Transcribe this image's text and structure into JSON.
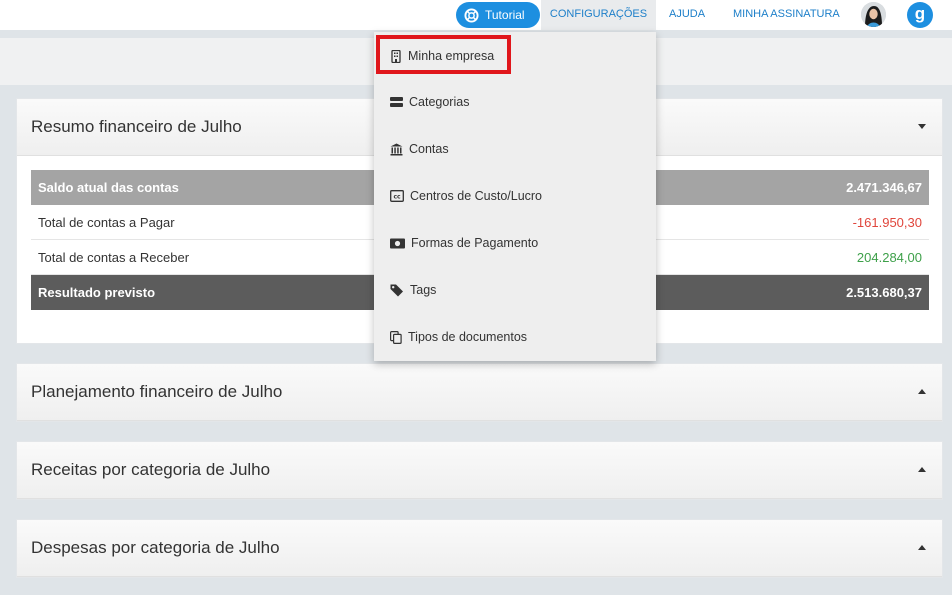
{
  "topbar": {
    "tutorial_label": "Tutorial",
    "nav": [
      "CONFIGURAÇÕES",
      "AJUDA",
      "MINHA ASSINATURA"
    ],
    "brand_letter": "g"
  },
  "dropdown": {
    "items": [
      {
        "label": "Minha empresa",
        "icon": "building-icon"
      },
      {
        "label": "Categorias",
        "icon": "categories-icon"
      },
      {
        "label": "Contas",
        "icon": "bank-icon"
      },
      {
        "label": "Centros de Custo/Lucro",
        "icon": "cc-icon"
      },
      {
        "label": "Formas de Pagamento",
        "icon": "money-icon"
      },
      {
        "label": "Tags",
        "icon": "tag-icon"
      },
      {
        "label": "Tipos de documentos",
        "icon": "documents-icon"
      }
    ]
  },
  "panels": {
    "resumo": {
      "title": "Resumo financeiro de Julho",
      "rows": [
        {
          "label": "Saldo atual das contas",
          "value": "2.471.346,67"
        },
        {
          "label": "Total de contas a Pagar",
          "value": "-161.950,30"
        },
        {
          "label": "Total de contas a Receber",
          "value": "204.284,00"
        },
        {
          "label": "Resultado previsto",
          "value": "2.513.680,37"
        }
      ]
    },
    "planejamento": {
      "title": "Planejamento financeiro de Julho"
    },
    "receitas": {
      "title": "Receitas por categoria de Julho"
    },
    "despesas": {
      "title": "Despesas por categoria de Julho"
    }
  },
  "colors": {
    "accent": "#1d8fe0",
    "negative": "#e0463c",
    "positive": "#3ea04a",
    "highlight": "#e0161b"
  }
}
